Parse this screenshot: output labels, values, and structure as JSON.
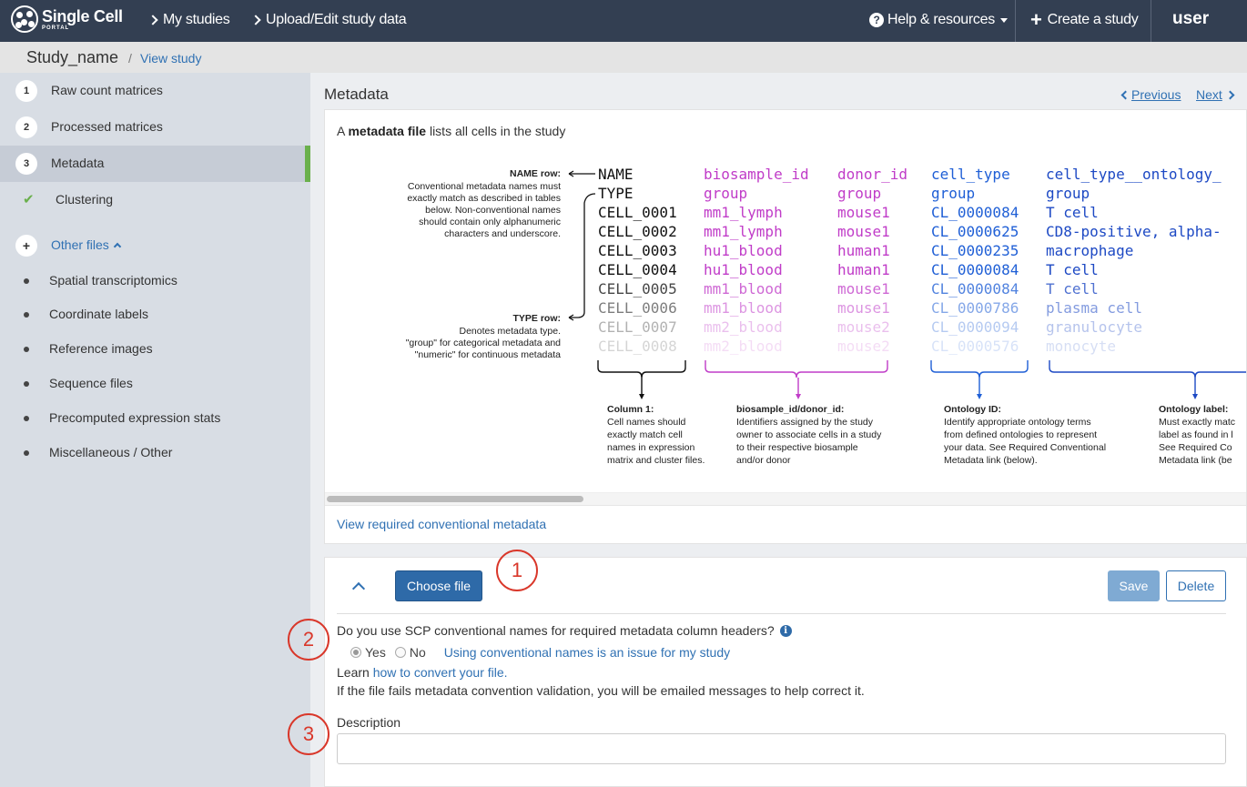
{
  "nav": {
    "logo_main": "Single Cell",
    "logo_sub": "PORTAL",
    "my_studies": "My studies",
    "upload_edit": "Upload/Edit study data",
    "help": "Help & resources",
    "create": "Create a study",
    "user": "user"
  },
  "breadcrumb": {
    "study": "Study_name",
    "separator": "/",
    "view": "View study"
  },
  "sidebar": {
    "steps": [
      {
        "num": "1",
        "label": "Raw count matrices"
      },
      {
        "num": "2",
        "label": "Processed matrices"
      },
      {
        "num": "3",
        "label": "Metadata"
      },
      {
        "label": "Clustering"
      }
    ],
    "other_files": {
      "icon": "+",
      "label": "Other files"
    },
    "sub_items": [
      "Spatial transcriptomics",
      "Coordinate labels",
      "Reference images",
      "Sequence files",
      "Precomputed expression stats",
      "Miscellaneous / Other"
    ]
  },
  "main": {
    "title": "Metadata",
    "previous": "Previous",
    "next": "Next",
    "intro_prefix": "A ",
    "intro_bold": "metadata file",
    "intro_suffix": " lists all cells in the study",
    "view_required": "View required conventional metadata"
  },
  "diagram": {
    "name_row_title": "NAME row:",
    "name_row_desc": [
      "Conventional metadata names must",
      "exactly match as described in tables",
      "below. Non-conventional names",
      "should contain only alphanumeric",
      "characters and underscore."
    ],
    "type_row_title": "TYPE row:",
    "type_row_desc": [
      "Denotes metadata type.",
      "\"group\" for categorical metadata and",
      "\"numeric\" for continuous metadata"
    ],
    "col1": [
      "NAME",
      "TYPE",
      "CELL_0001",
      "CELL_0002",
      "CELL_0003",
      "CELL_0004",
      "CELL_0005",
      "CELL_0006",
      "CELL_0007",
      "CELL_0008"
    ],
    "col2": [
      "biosample_id",
      "group",
      "mm1_lymph",
      "mm1_lymph",
      "hu1_blood",
      "hu1_blood",
      "mm1_blood",
      "mm1_blood",
      "mm2_blood",
      "mm2_blood"
    ],
    "col3": [
      "donor_id",
      "group",
      "mouse1",
      "mouse1",
      "human1",
      "human1",
      "mouse1",
      "mouse1",
      "mouse2",
      "mouse2"
    ],
    "col4": [
      "cell_type",
      "group",
      "CL_0000084",
      "CL_0000625",
      "CL_0000235",
      "CL_0000084",
      "CL_0000084",
      "CL_0000786",
      "CL_0000094",
      "CL_0000576"
    ],
    "col5": [
      "cell_type__ontology_",
      "group",
      "T cell",
      "CD8-positive, alpha-",
      "macrophage",
      "T cell",
      "T cell",
      "plasma cell",
      "granulocyte",
      "monocyte"
    ],
    "notes": [
      {
        "title": "Column 1:",
        "lines": [
          "Cell names should",
          "exactly match cell",
          "names in expression",
          "matrix and cluster files."
        ]
      },
      {
        "title": "biosample_id/donor_id:",
        "lines": [
          "Identifiers assigned by the study",
          "owner to associate cells in a study",
          "to their respective biosample",
          "and/or donor"
        ]
      },
      {
        "title": "Ontology ID:",
        "lines": [
          "Identify appropriate ontology terms",
          "from defined ontologies to represent",
          "your data. See Required Conventional",
          "Metadata link (below)."
        ]
      },
      {
        "title": "Ontology label:",
        "lines": [
          "Must exactly matc",
          "label as found in l",
          "See Required Co",
          "Metadata link (be"
        ]
      }
    ],
    "colors": {
      "black": "#111111",
      "magenta": "#c03cc8",
      "blue": "#1f5fd6",
      "darkblue": "#1d49c4"
    }
  },
  "form": {
    "choose_file": "Choose file",
    "save": "Save",
    "delete": "Delete",
    "question": "Do you use SCP conventional names for required metadata column headers?",
    "info_icon": "i",
    "yes": "Yes",
    "no": "No",
    "issue_link": "Using conventional names is an issue for my study",
    "learn_prefix": "Learn ",
    "learn_link": "how to convert your file.",
    "fails_text": "If the file fails metadata convention validation, you will be emailed messages to help correct it.",
    "description_label": "Description",
    "description_value": ""
  },
  "callouts": [
    "1",
    "2",
    "3"
  ]
}
